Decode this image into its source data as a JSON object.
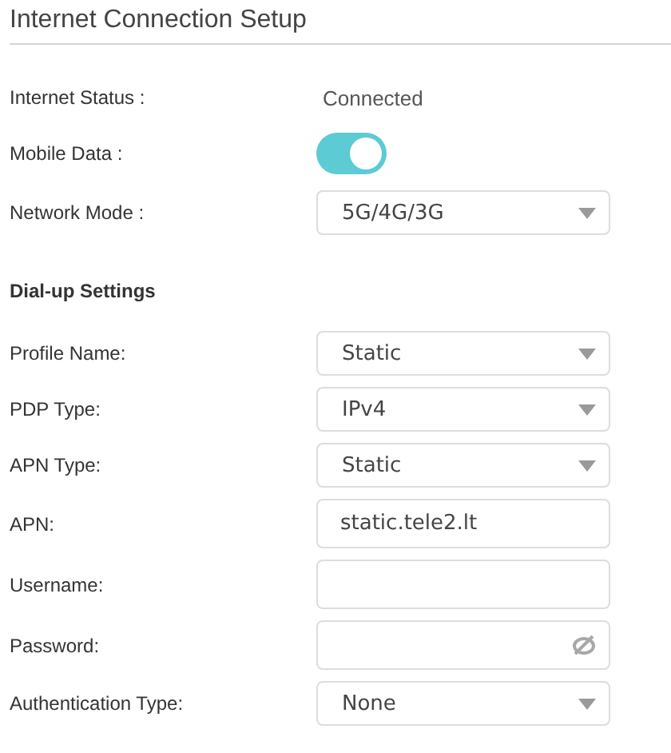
{
  "title": "Internet Connection Setup",
  "status": {
    "label": "Internet Status :",
    "value": "Connected"
  },
  "mobile_data": {
    "label": "Mobile Data :",
    "on": true
  },
  "network_mode": {
    "label": "Network Mode :",
    "value": "5G/4G/3G"
  },
  "section_title": "Dial-up Settings",
  "fields": [
    {
      "label": "Profile Name:",
      "kind": "select",
      "value": "Static"
    },
    {
      "label": "PDP Type:",
      "kind": "select",
      "value": "IPv4"
    },
    {
      "label": "APN Type:",
      "kind": "select",
      "value": "Static"
    },
    {
      "label": "APN:",
      "kind": "text",
      "value": "static.tele2.lt"
    },
    {
      "label": "Username:",
      "kind": "text"
    },
    {
      "label": "Password:",
      "kind": "password"
    },
    {
      "label": "Authentication Type:",
      "kind": "select",
      "value": "None"
    }
  ]
}
